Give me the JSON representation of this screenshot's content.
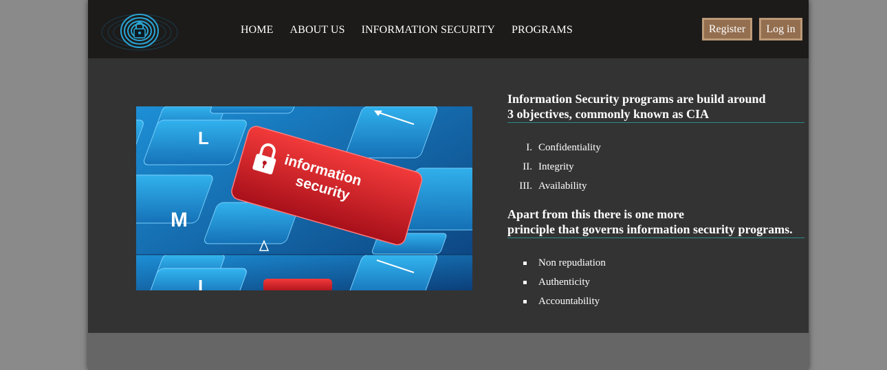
{
  "nav": {
    "logo_icon": "fingerprint-lock-icon",
    "links": [
      "HOME",
      "ABOUT US",
      "INFORMATION SECURITY",
      "PROGRAMS"
    ],
    "register_label": "Register",
    "login_label": "Log in"
  },
  "hero_image": {
    "key_text_line1": "information",
    "key_text_line2": "security",
    "key_letters": [
      "L",
      "M"
    ],
    "key_icon": "padlock-icon"
  },
  "info": {
    "heading1_line1": "Information Security programs are build around",
    "heading1_line2": "3 objectives, commonly known as CIA",
    "cia": [
      {
        "num": "I.",
        "label": "Confidentiality"
      },
      {
        "num": "II.",
        "label": "Integrity"
      },
      {
        "num": "III.",
        "label": "Availability"
      }
    ],
    "heading2_line1": "Apart from this there is one more",
    "heading2_line2": "principle that governs information security programs.",
    "extras": [
      "Non repudiation",
      "Authenticity",
      "Accountability"
    ]
  },
  "colors": {
    "page_bg": "#333333",
    "navbar_bg": "#1c1b1a",
    "button_bg": "#936e4f",
    "button_border": "#bd9a78",
    "heading_underline": "#2f8c8c",
    "footer_bg": "#666666"
  }
}
